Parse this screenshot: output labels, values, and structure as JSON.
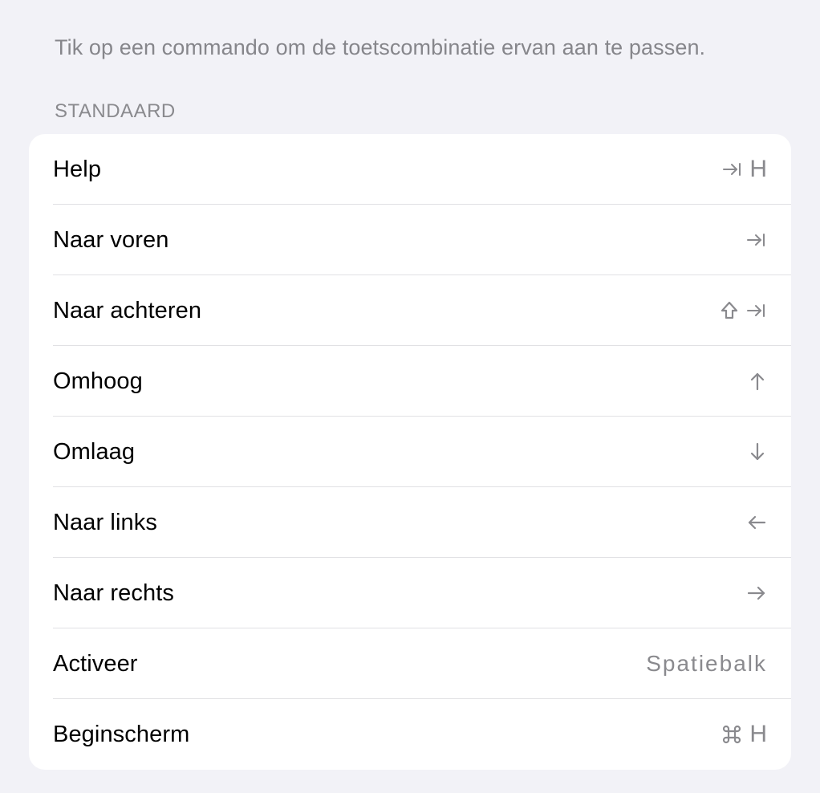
{
  "intro_text": "Tik op een commando om de toetscombinatie ervan aan te passen.",
  "section_header": "Standaard",
  "rows": [
    {
      "label": "Help",
      "shortcut_glyphs": [
        "tab",
        "letter"
      ],
      "letter": "H"
    },
    {
      "label": "Naar voren",
      "shortcut_glyphs": [
        "tab"
      ]
    },
    {
      "label": "Naar achteren",
      "shortcut_glyphs": [
        "shift",
        "tab"
      ]
    },
    {
      "label": "Omhoog",
      "shortcut_glyphs": [
        "arrow-up"
      ]
    },
    {
      "label": "Omlaag",
      "shortcut_glyphs": [
        "arrow-down"
      ]
    },
    {
      "label": "Naar links",
      "shortcut_glyphs": [
        "arrow-left"
      ]
    },
    {
      "label": "Naar rechts",
      "shortcut_glyphs": [
        "arrow-right"
      ]
    },
    {
      "label": "Activeer",
      "shortcut_text": "Spatiebalk"
    },
    {
      "label": "Beginscherm",
      "shortcut_glyphs": [
        "command",
        "letter"
      ],
      "letter": "H"
    }
  ]
}
